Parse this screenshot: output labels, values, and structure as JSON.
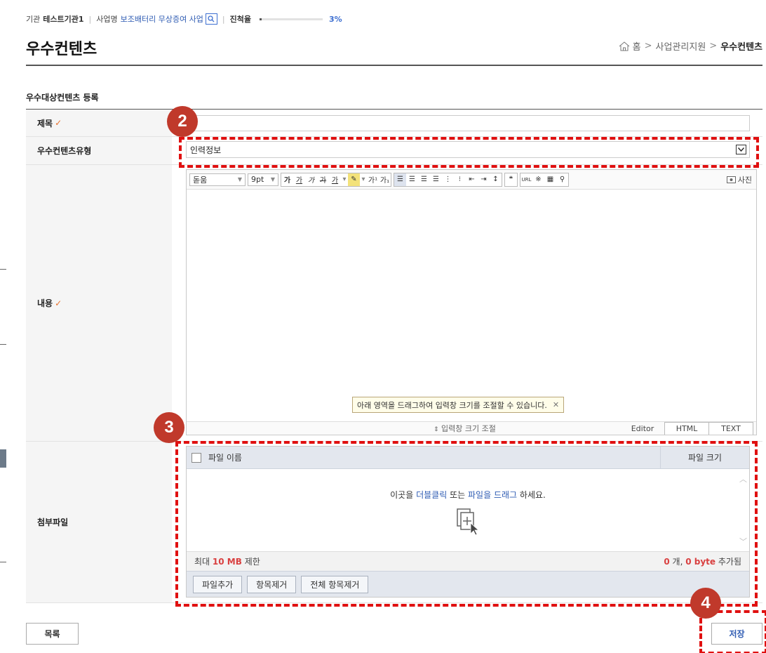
{
  "topbar": {
    "org_label": "기관",
    "org_value": "테스트기관1",
    "project_label": "사업명",
    "project_value": "보조배터리 무상증여 사업",
    "progress_label": "진척율",
    "progress_value": "3%",
    "progress_fraction": 0.03
  },
  "page": {
    "title": "우수컨텐츠",
    "breadcrumb": [
      "홈",
      "사업관리지원",
      "우수컨텐츠"
    ]
  },
  "form": {
    "section_title": "우수대상컨텐츠 등록",
    "title_label": "제목",
    "title_value": "",
    "type_label": "우수컨텐츠유형",
    "type_selected": "인력정보",
    "content_label": "내용",
    "attach_label": "첨부파일"
  },
  "editor": {
    "font_family": "돋움",
    "font_size": "9pt",
    "photo_label": "사진",
    "resize_tooltip": "아래 영역을 드래그하여 입력창 크기를 조절할 수 있습니다.",
    "resize_label": "입력창 크기 조절",
    "modes": [
      "Editor",
      "HTML",
      "TEXT"
    ]
  },
  "attach": {
    "col_name": "파일 이름",
    "col_size": "파일 크기",
    "drop_prefix": "이곳을",
    "drop_dblclick": "더블클릭",
    "drop_middle": "또는",
    "drop_drag": "파일을 드래그",
    "drop_suffix": "하세요.",
    "limit_prefix": "최대",
    "limit_value": "10 MB",
    "limit_suffix": "제한",
    "count_value": "0",
    "count_unit": "개,",
    "bytes_value": "0 byte",
    "added_label": "추가됨",
    "btn_add": "파일추가",
    "btn_remove": "항목제거",
    "btn_remove_all": "전체 항목제거"
  },
  "buttons": {
    "list": "목록",
    "save": "저장"
  },
  "annotations": [
    "2",
    "3",
    "4"
  ],
  "colors": {
    "annotation": "#e01010",
    "badge": "#c0392b",
    "link": "#2f5cb3",
    "required": "#e8732f"
  }
}
